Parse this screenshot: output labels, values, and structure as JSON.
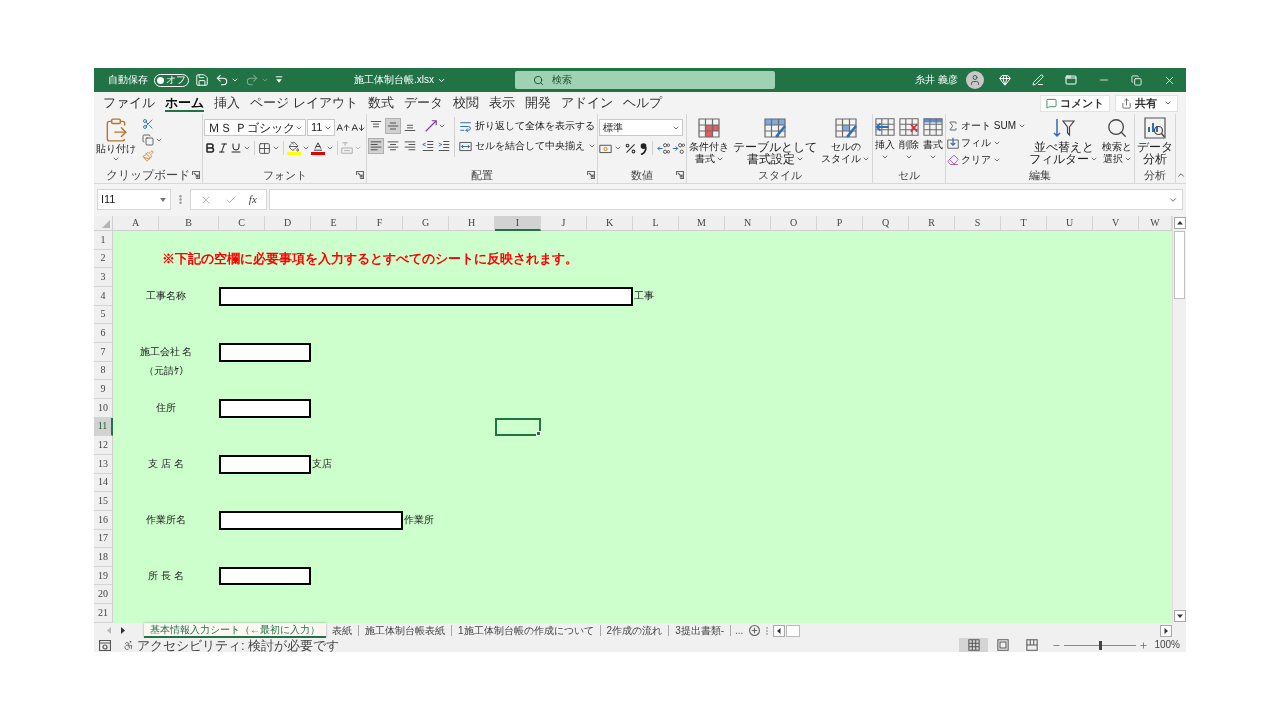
{
  "title_bar": {
    "autosave_label": "自動保存",
    "autosave": {
      "label": "オフ",
      "on": false
    },
    "quick_access": [
      {
        "kind": "save",
        "disabled": false
      },
      {
        "kind": "undo",
        "disabled": false
      },
      {
        "kind": "redo",
        "disabled": true
      },
      {
        "kind": "customize",
        "disabled": false
      }
    ],
    "file_name": "施工体制台帳.xlsx",
    "search": {
      "placeholder": "検索"
    },
    "user_name": "糸井 義彦"
  },
  "menu_tabs": [
    {
      "label": "ファイル",
      "selected": false
    },
    {
      "label": "ホーム",
      "selected": true
    },
    {
      "label": "挿入",
      "selected": false
    },
    {
      "label": "ページ レイアウト",
      "selected": false
    },
    {
      "label": "数式",
      "selected": false
    },
    {
      "label": "データ",
      "selected": false
    },
    {
      "label": "校閲",
      "selected": false
    },
    {
      "label": "表示",
      "selected": false
    },
    {
      "label": "開発",
      "selected": false
    },
    {
      "label": "アドイン",
      "selected": false
    },
    {
      "label": "ヘルプ",
      "selected": false
    }
  ],
  "menu_actions": {
    "comment": "コメント",
    "share": "共有"
  },
  "ribbon": {
    "groups": [
      {
        "kind": "clipboard",
        "label": "クリップボード",
        "paste": "貼り付け"
      },
      {
        "kind": "font",
        "label": "フォント",
        "font_name": "ＭＳ Ｐゴシック",
        "font_size": "11"
      },
      {
        "kind": "alignment",
        "label": "配置",
        "vertical_align": [
          {
            "kind": "top",
            "selected": false
          },
          {
            "kind": "middle",
            "selected": true
          },
          {
            "kind": "bottom",
            "selected": false
          }
        ],
        "horizontal_align": [
          {
            "kind": "left",
            "selected": true
          },
          {
            "kind": "center",
            "selected": false
          },
          {
            "kind": "right",
            "selected": false
          }
        ],
        "wrap_text": "折り返して全体を表示する",
        "merge_center": "セルを結合して中央揃え"
      },
      {
        "kind": "number",
        "label": "数値",
        "format": "標準"
      },
      {
        "kind": "styles",
        "label": "スタイル",
        "buttons": [
          {
            "kind": "conditional",
            "lines": [
              "条件付き",
              "書式"
            ]
          },
          {
            "kind": "table",
            "lines": [
              "テーブルとして",
              "書式設定"
            ]
          },
          {
            "kind": "cell_styles",
            "lines": [
              "セルの",
              "スタイル"
            ]
          }
        ]
      },
      {
        "kind": "cells",
        "label": "セル",
        "buttons": [
          {
            "kind": "insert",
            "label": "挿入"
          },
          {
            "kind": "delete",
            "label": "削除"
          },
          {
            "kind": "format",
            "label": "書式"
          }
        ]
      },
      {
        "kind": "editing",
        "label": "編集",
        "small_buttons": [
          {
            "kind": "autosum",
            "label": "オート SUM"
          },
          {
            "kind": "fill",
            "label": "フィル"
          },
          {
            "kind": "clear",
            "label": "クリア"
          }
        ],
        "big_buttons": [
          {
            "kind": "sort_filter",
            "lines": [
              "並べ替えと",
              "フィルター"
            ]
          },
          {
            "kind": "find",
            "lines": [
              "検索と",
              "選択"
            ]
          }
        ]
      },
      {
        "kind": "analysis",
        "label": "分析",
        "lines": [
          "データ",
          "分析"
        ]
      }
    ]
  },
  "formula_bar": {
    "name_box": "I11",
    "function_button": "fx"
  },
  "sheet": {
    "columns": [
      {
        "label": "A",
        "selected": false
      },
      {
        "label": "B",
        "selected": false
      },
      {
        "label": "C",
        "selected": false
      },
      {
        "label": "D",
        "selected": false
      },
      {
        "label": "E",
        "selected": false
      },
      {
        "label": "F",
        "selected": false
      },
      {
        "label": "G",
        "selected": false
      },
      {
        "label": "H",
        "selected": false
      },
      {
        "label": "I",
        "selected": true
      },
      {
        "label": "J",
        "selected": false
      },
      {
        "label": "K",
        "selected": false
      },
      {
        "label": "L",
        "selected": false
      },
      {
        "label": "M",
        "selected": false
      },
      {
        "label": "N",
        "selected": false
      },
      {
        "label": "O",
        "selected": false
      },
      {
        "label": "P",
        "selected": false
      },
      {
        "label": "Q",
        "selected": false
      },
      {
        "label": "R",
        "selected": false
      },
      {
        "label": "S",
        "selected": false
      },
      {
        "label": "T",
        "selected": false
      },
      {
        "label": "U",
        "selected": false
      },
      {
        "label": "V",
        "selected": false
      },
      {
        "label": "W",
        "selected": false
      }
    ],
    "rows": [
      {
        "label": "1",
        "selected": false
      },
      {
        "label": "2",
        "selected": false
      },
      {
        "label": "3",
        "selected": false
      },
      {
        "label": "4",
        "selected": false
      },
      {
        "label": "5",
        "selected": false
      },
      {
        "label": "6",
        "selected": false
      },
      {
        "label": "7",
        "selected": false
      },
      {
        "label": "8",
        "selected": false
      },
      {
        "label": "9",
        "selected": false
      },
      {
        "label": "10",
        "selected": false
      },
      {
        "label": "11",
        "selected": true
      },
      {
        "label": "12",
        "selected": false
      },
      {
        "label": "13",
        "selected": false
      },
      {
        "label": "14",
        "selected": false
      },
      {
        "label": "15",
        "selected": false
      },
      {
        "label": "16",
        "selected": false
      },
      {
        "label": "17",
        "selected": false
      },
      {
        "label": "18",
        "selected": false
      },
      {
        "label": "19",
        "selected": false
      },
      {
        "label": "20",
        "selected": false
      },
      {
        "label": "21",
        "selected": false
      }
    ],
    "notice": "※下記の空欄に必要事項を入力するとすべてのシートに反映されます。",
    "fields": [
      {
        "label": "工事名称",
        "suffix": "工事"
      },
      {
        "label": "施工会社 名",
        "sublabel": "（元請ｹ）"
      },
      {
        "label": "住所"
      },
      {
        "label": "支 店 名",
        "suffix": "支店"
      },
      {
        "label": "作業所名",
        "suffix": "作業所"
      },
      {
        "label": "所 長 名"
      }
    ]
  },
  "sheet_tabs": [
    {
      "label": "基本情報入力シート（←最初に入力）",
      "selected": true
    },
    {
      "label": "表紙",
      "selected": false
    },
    {
      "label": "施工体制台帳表紙",
      "selected": false
    },
    {
      "label": "1施工体制台帳の作成について",
      "selected": false
    },
    {
      "label": "2作成の流れ",
      "selected": false
    },
    {
      "label": "3提出書類-",
      "selected": false
    }
  ],
  "more_sheets": "...",
  "status_bar": {
    "accessibility": "アクセシビリティ: 検討が必要です",
    "views": [
      {
        "kind": "normal",
        "selected": true
      },
      {
        "kind": "page_layout",
        "selected": false
      },
      {
        "kind": "page_break",
        "selected": false
      }
    ],
    "zoom": {
      "level": 0.5,
      "reading": "100%"
    }
  }
}
